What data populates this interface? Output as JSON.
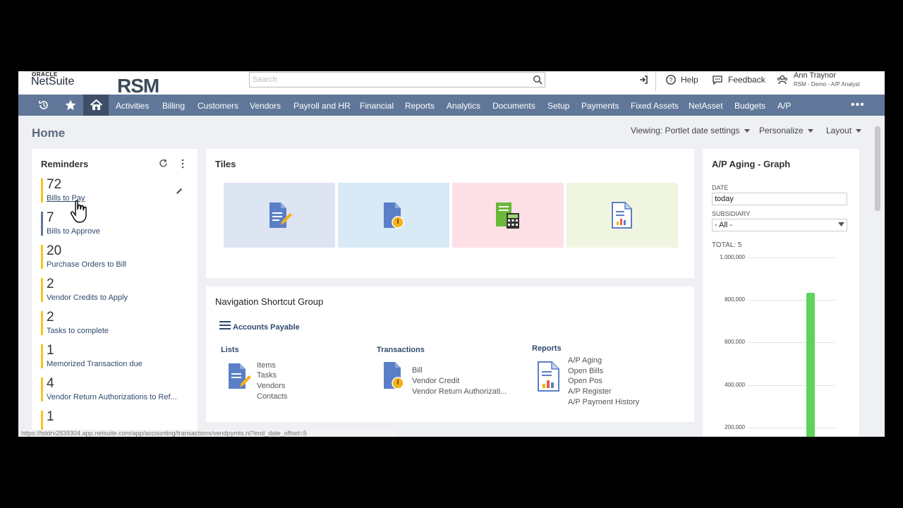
{
  "header": {
    "oracle": "ORACLE",
    "netsuite": "NetSuite",
    "brand": "RSM",
    "search_placeholder": "Search",
    "help": "Help",
    "feedback": "Feedback",
    "user_name": "Ann Traynor",
    "user_role": "RSM - Demo - A/P Analyst"
  },
  "nav": {
    "items": [
      "Activities",
      "Billing",
      "Customers",
      "Vendors",
      "Payroll and HR",
      "Financial",
      "Reports",
      "Analytics",
      "Documents",
      "Setup",
      "Payments",
      "Fixed Assets",
      "NetAsset",
      "Budgets",
      "A/P"
    ],
    "more": "•••"
  },
  "page": {
    "title": "Home",
    "viewing": "Viewing: Portlet date settings",
    "personalize": "Personalize",
    "layout": "Layout"
  },
  "reminders": {
    "title": "Reminders",
    "items": [
      {
        "count": "72",
        "label": "Bills to Pay",
        "color": "#f5c518"
      },
      {
        "count": "7",
        "label": "Bills to Approve",
        "color": "#607799"
      },
      {
        "count": "20",
        "label": "Purchase Orders to Bill",
        "color": "#f5c518"
      },
      {
        "count": "2",
        "label": "Vendor Credits to Apply",
        "color": "#f5c518"
      },
      {
        "count": "2",
        "label": "Tasks to complete",
        "color": "#f5c518"
      },
      {
        "count": "1",
        "label": "Memorized Transaction due",
        "color": "#f5c518"
      },
      {
        "count": "4",
        "label": "Vendor Return Authorizations to Ref...",
        "color": "#f5c518"
      },
      {
        "count": "1",
        "label": "",
        "color": "#f5c518"
      }
    ]
  },
  "tiles": {
    "title": "Tiles",
    "colors": [
      "#dde5f3",
      "#d7eaf5",
      "#fde0e6",
      "#f0f5e1"
    ]
  },
  "nav_shortcuts": {
    "title": "Navigation Shortcut Group",
    "group": "Accounts Payable",
    "lists_title": "Lists",
    "lists": [
      "Items",
      "Tasks",
      "Vendors",
      "Contacts"
    ],
    "transactions_title": "Transactions",
    "transactions": [
      "Bill",
      "Vendor Credit",
      "Vendor Return Authorizati..."
    ],
    "reports_title": "Reports",
    "reports": [
      "A/P Aging",
      "Open Bills",
      "Open Pos",
      "A/P Register",
      "A/P Payment History"
    ]
  },
  "ap_aging": {
    "title": "A/P Aging - Graph",
    "date_label": "DATE",
    "date_value": "today",
    "subsidiary_label": "SUBSIDIARY",
    "subsidiary_value": "- All -",
    "total": "TOTAL: 5"
  },
  "chart_data": {
    "type": "bar",
    "yticks": [
      "1,000,000",
      "800,000",
      "600,000",
      "400,000",
      "200,000"
    ],
    "ylim": [
      0,
      1000000
    ],
    "bars": [
      {
        "value": 835000,
        "color": "#5fd35a"
      }
    ]
  },
  "status_url": "https://tstdrv2839304.app.netsuite.com/app/accounting/transactions/vendpymts.nl?end_date_offset=5"
}
